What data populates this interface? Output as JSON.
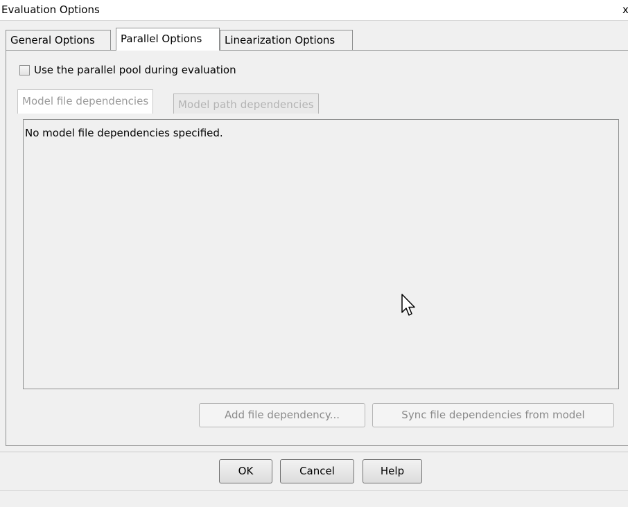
{
  "window": {
    "title": "Evaluation Options",
    "close_glyph": "x"
  },
  "tabs": [
    {
      "label": "General Options",
      "active": false
    },
    {
      "label": "Parallel Options",
      "active": true
    },
    {
      "label": "Linearization Options",
      "active": false
    }
  ],
  "parallel": {
    "use_pool_label": "Use the parallel pool during evaluation",
    "use_pool_checked": false
  },
  "inner_tabs": [
    {
      "label": "Model file dependencies",
      "active": true
    },
    {
      "label": "Model path dependencies",
      "active": false
    }
  ],
  "dependencies": {
    "empty_message": "No model file dependencies specified.",
    "add_button": "Add file dependency...",
    "sync_button": "Sync file dependencies from model"
  },
  "footer": {
    "ok": "OK",
    "cancel": "Cancel",
    "help": "Help"
  },
  "icons": {
    "cursor": "mouse-pointer-icon"
  }
}
